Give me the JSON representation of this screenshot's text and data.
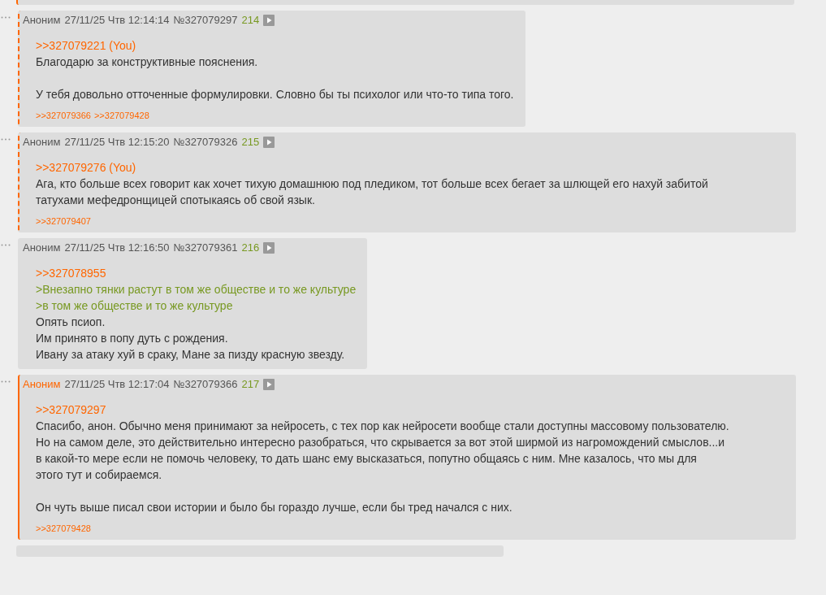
{
  "posts": [
    {
      "kind": "partial",
      "own": true
    },
    {
      "kind": "post",
      "reply_to_you": true,
      "own": false,
      "author": "Аноним",
      "date": "27/11/25 Чтв 12:14:14",
      "number": "№327079297",
      "ordinal": "214",
      "blocks": [
        [
          {
            "kind": "link",
            "text": ">>327079221 (You)"
          },
          {
            "kind": "text",
            "text": "Благодарю за конструктивные пояснения."
          }
        ],
        [
          {
            "kind": "text",
            "text": "У тебя довольно отточенные формулировки. Словно бы ты психолог или что-то типа того."
          }
        ]
      ],
      "replies": [
        ">>327079366",
        ">>327079428"
      ]
    },
    {
      "kind": "post",
      "reply_to_you": true,
      "own": false,
      "author": "Аноним",
      "date": "27/11/25 Чтв 12:15:20",
      "number": "№327079326",
      "ordinal": "215",
      "blocks": [
        [
          {
            "kind": "link",
            "text": ">>327079276 (You)"
          },
          {
            "kind": "text",
            "text": "Ага, кто больше всех говорит как хочет тихую домашнюю под пледиком, тот больше всех бегает за шлющей его нахуй забитой"
          },
          {
            "kind": "text",
            "text": "татухами мефедронщицей спотыкаясь об свой язык."
          }
        ]
      ],
      "replies": [
        ">>327079407"
      ]
    },
    {
      "kind": "post",
      "reply_to_you": false,
      "own": false,
      "author": "Аноним",
      "date": "27/11/25 Чтв 12:16:50",
      "number": "№327079361",
      "ordinal": "216",
      "blocks": [
        [
          {
            "kind": "link",
            "text": ">>327078955"
          },
          {
            "kind": "quote",
            "text": ">Внезапно тянки растут в том же обществе и то же культуре"
          },
          {
            "kind": "quote",
            "text": ">в том же обществе и то же культуре"
          },
          {
            "kind": "text",
            "text": "Опять псиоп."
          },
          {
            "kind": "text",
            "text": "Им принято в попу дуть с рождения."
          },
          {
            "kind": "text",
            "text": "Ивану за атаку хуй в сраку, Мане за пизду красную звезду."
          }
        ]
      ]
    },
    {
      "kind": "post",
      "reply_to_you": false,
      "own": true,
      "author": "Аноним",
      "date": "27/11/25 Чтв 12:17:04",
      "number": "№327079366",
      "ordinal": "217",
      "blocks": [
        [
          {
            "kind": "link",
            "text": ">>327079297"
          },
          {
            "kind": "text",
            "text": "Спасибо, анон. Обычно меня принимают за нейросеть, с тех пор как нейросети вообще стали доступны массовому пользователю."
          },
          {
            "kind": "text",
            "text": "Но на самом деле, это действительно интересно разобраться, что скрывается за вот этой ширмой из нагромождений смыслов...и"
          },
          {
            "kind": "text",
            "text": "в какой-то мере если не помочь человеку, то дать шанс ему высказаться, попутно общаясь с ним. Мне казалось, что мы для"
          },
          {
            "kind": "text",
            "text": "этого тут и собираемся."
          }
        ],
        [
          {
            "kind": "text",
            "text": "Он чуть выше писал свои истории и было бы гораздо лучше, если бы тред начался с них."
          }
        ]
      ],
      "replies": [
        ">>327079428"
      ]
    },
    {
      "kind": "partial",
      "own": false
    }
  ]
}
